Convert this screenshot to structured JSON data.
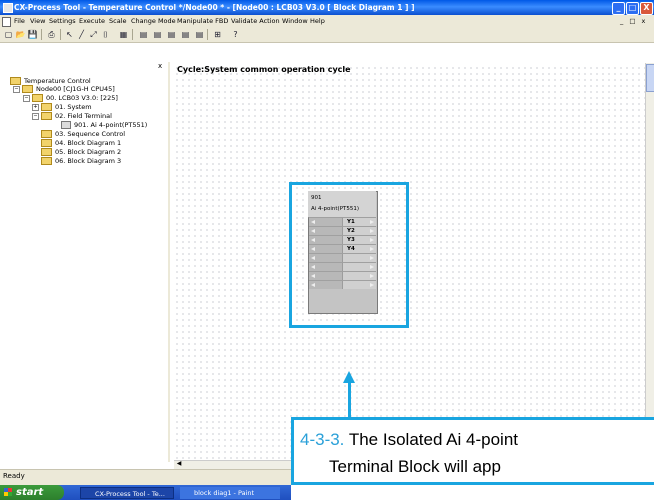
{
  "window": {
    "title": "CX-Process Tool - Temperature Control */Node00 * - [Node00 : LCB03 V3.0 [ Block Diagram 1 ] ]",
    "minimize": "_",
    "maximize": "□",
    "close": "X",
    "inner_restore": "_ □ x"
  },
  "menu": [
    "File",
    "View",
    "Settings",
    "Execute",
    "Scale",
    "Change Mode",
    "Manipulate FBD",
    "Validate Action",
    "Window",
    "Help"
  ],
  "toolbar": {
    "icons": [
      "new-icon",
      "open-icon",
      "save-icon",
      "print-icon",
      "pointer-icon",
      "line-icon",
      "connect-icon",
      "block-icon",
      "grid-icon",
      "align-icon",
      "view-icon",
      "help-icon"
    ],
    "glyphs": [
      "▢",
      "📂",
      "💾",
      "⎙",
      "↖",
      "╱",
      "⤢",
      "⌷",
      "▦",
      "▤",
      "⊞",
      "?"
    ]
  },
  "tree": {
    "close": "x",
    "items": [
      {
        "label": "Temperature Control",
        "level": 0,
        "kind": "folder",
        "expander": ""
      },
      {
        "label": "Node00 [CJ1G-H CPU45]",
        "level": 1,
        "kind": "folder",
        "expander": "−"
      },
      {
        "label": "00. LCB03 V3.0: [225]",
        "level": 2,
        "kind": "folder",
        "expander": "−"
      },
      {
        "label": "01. System",
        "level": 3,
        "kind": "folder",
        "expander": "+"
      },
      {
        "label": "02. Field Terminal",
        "level": 3,
        "kind": "folder",
        "expander": "−"
      },
      {
        "label": "901. Ai 4-point(PT551)",
        "level": 4,
        "kind": "block",
        "expander": ""
      },
      {
        "label": "03. Sequence Control",
        "level": 3,
        "kind": "folder",
        "expander": ""
      },
      {
        "label": "04. Block Diagram 1",
        "level": 3,
        "kind": "folder",
        "expander": ""
      },
      {
        "label": "05. Block Diagram 2",
        "level": 3,
        "kind": "folder",
        "expander": ""
      },
      {
        "label": "06. Block Diagram 3",
        "level": 3,
        "kind": "folder",
        "expander": ""
      }
    ]
  },
  "diagram": {
    "title": "Cycle:System common operation cycle",
    "block": {
      "number": "901",
      "name": "Ai 4-point(PT551)",
      "outputs": [
        "Y1",
        "Y2",
        "Y3",
        "Y4",
        "",
        "",
        "",
        ""
      ]
    }
  },
  "callout": {
    "step": "4-3-3.",
    "line1": "The Isolated Ai 4-point",
    "line2": "Terminal Block will app"
  },
  "status": {
    "text": "Ready"
  },
  "taskbar": {
    "start": "start",
    "tasks": [
      "CX-Process Tool - Te...",
      "block diag1 - Paint"
    ]
  },
  "colors": {
    "highlight": "#19a5e0",
    "titlebar": "#0058e6",
    "step_number": "#2aa0d8"
  }
}
